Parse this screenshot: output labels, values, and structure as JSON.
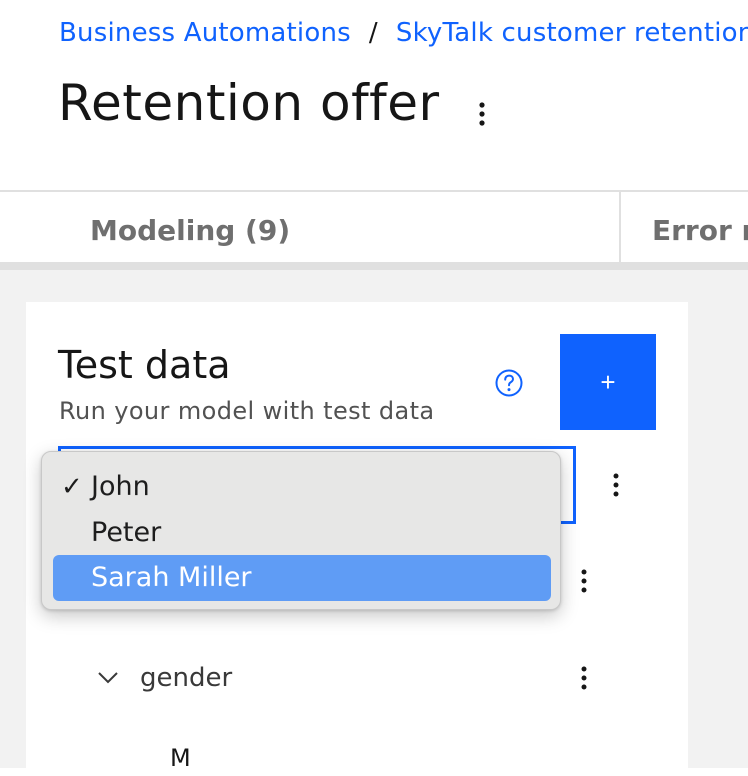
{
  "breadcrumb": {
    "items": [
      "Business Automations",
      "SkyTalk customer retention"
    ],
    "separator": "/"
  },
  "page": {
    "title": "Retention offer"
  },
  "tabs": {
    "modeling": "Modeling (9)",
    "errors": "Error r"
  },
  "test_data": {
    "title": "Test data",
    "subtitle": "Run your model with test data",
    "add_label": "+"
  },
  "dropdown": {
    "options": [
      {
        "label": "John",
        "checked": true,
        "highlighted": false
      },
      {
        "label": "Peter",
        "checked": false,
        "highlighted": false
      },
      {
        "label": "Sarah Miller",
        "checked": false,
        "highlighted": true
      }
    ],
    "check_glyph": "✓"
  },
  "tree": {
    "field_label": "gender",
    "field_value": "M"
  },
  "colors": {
    "accent": "#0f62fe",
    "highlight": "#5f9cf5",
    "background_gray": "#f2f2f2"
  }
}
